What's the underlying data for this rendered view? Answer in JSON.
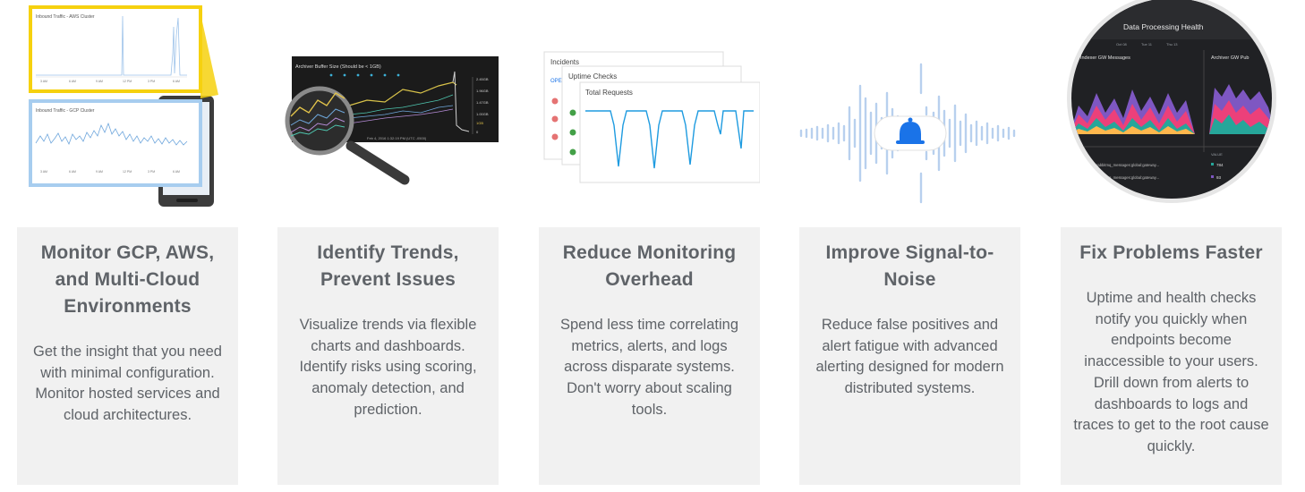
{
  "features": [
    {
      "title": "Monitor GCP, AWS, and Multi-Cloud Environments",
      "description": "Get the insight that you need with minimal configuration. Monitor hosted services and cloud architectures.",
      "illustration": {
        "top_panel_title": "Inbound Traffic - AWS Cluster",
        "bottom_panel_title": "Inbound Traffic - GCP Cluster",
        "top_time_ticks": [
          "3 AM",
          "6 AM",
          "9 AM",
          "12 PM",
          "3 PM",
          "6 AM"
        ],
        "bottom_time_ticks": [
          "3 AM",
          "6 AM",
          "9 AM",
          "12 PM",
          "3 PM",
          "6 AM"
        ],
        "accent_top": "#f6d10f",
        "accent_bottom": "#a7cdef"
      }
    },
    {
      "title": "Identify Trends, Prevent Issues",
      "description": "Visualize trends via flexible charts and dashboards. Identify risks using scoring, anomaly detection, and prediction.",
      "illustration": {
        "chart_title": "Archiver Buffer Size (Should be < 1GB)",
        "y_ticks": [
          "2.45GB",
          "1.96GB",
          "1.47GB",
          "1.00GB",
          "1GB",
          "0"
        ],
        "footer": "Feb 4, 2016 1:32:19 PM (UTC -0500)"
      }
    },
    {
      "title": "Reduce Monitoring Overhead",
      "description": "Spend less time correlating metrics, alerts, and logs across disparate systems. Don't worry about scaling tools.",
      "illustration": {
        "card1_title": "Incidents",
        "card1_tab": "OPEN",
        "card2_title": "Uptime Checks",
        "card3_title": "Total Requests"
      }
    },
    {
      "title": "Improve Signal-to-Noise",
      "description": "Reduce false positives and alert fatigue with advanced alerting designed for modern distributed systems.",
      "illustration": {
        "icon": "bell-icon",
        "accent": "#1a73e8"
      }
    },
    {
      "title": "Fix Problems Faster",
      "description": "Uptime and health checks notify you quickly when endpoints become inaccessible to your users. Drill down from alerts to dashboards to logs and traces to get to the root cause quickly.",
      "illustration": {
        "header": "Data Processing Health",
        "panel_left": "vent Indexer GW Messages",
        "panel_right": "Archiver GW Pub",
        "dates": [
          "Oct 08",
          "Tue 11",
          "Thu 13"
        ],
        "rows": [
          "rabbitmq_messages:global:gateway...",
          "rabbitmq_messages:global:gateway..."
        ],
        "values": [
          "784",
          "93"
        ],
        "col_label": "VALUE"
      }
    }
  ]
}
